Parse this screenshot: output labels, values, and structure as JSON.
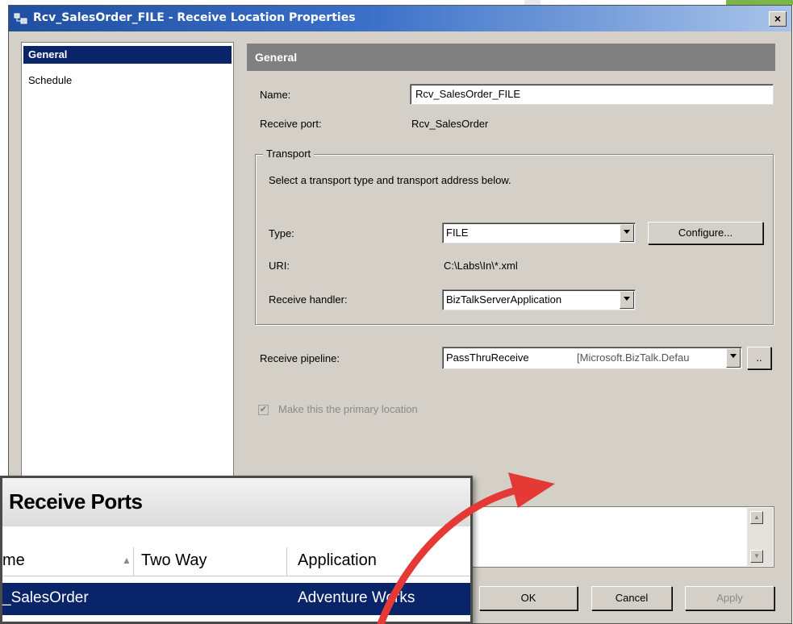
{
  "dialog": {
    "title": "Rcv_SalesOrder_FILE - Receive Location Properties",
    "close_glyph": "×"
  },
  "nav": {
    "items": [
      {
        "label": "General",
        "selected": true
      },
      {
        "label": "Schedule",
        "selected": false
      }
    ]
  },
  "general": {
    "header": "General",
    "name_label": "Name:",
    "name_value": "Rcv_SalesOrder_FILE",
    "receive_port_label": "Receive port:",
    "receive_port_value": "Rcv_SalesOrder",
    "transport": {
      "legend": "Transport",
      "instruction": "Select a transport type and transport address below.",
      "type_label": "Type:",
      "type_value": "FILE",
      "configure_label": "Configure...",
      "uri_label": "URI:",
      "uri_value": "C:\\Labs\\In\\*.xml",
      "handler_label": "Receive handler:",
      "handler_value": "BizTalkServerApplication"
    },
    "pipeline_label": "Receive pipeline:",
    "pipeline_name": "PassThruReceive",
    "pipeline_assembly": "[Microsoft.BizTalk.Defau",
    "pipeline_browse": "..",
    "primary_location_label": "Make this the primary location",
    "primary_location_checked": true
  },
  "buttons": {
    "ok": "OK",
    "cancel": "Cancel",
    "apply": "Apply"
  },
  "receive_ports": {
    "title": "Receive Ports",
    "columns": [
      "me",
      "Two Way",
      "Application"
    ],
    "sort_glyph": "▲",
    "row": {
      "name": "_SalesOrder",
      "application": "Adventure Works"
    }
  },
  "colors": {
    "selection": "#0a246a",
    "arrow": "#e53935",
    "dialog_face": "#d4d0c8"
  },
  "icons": [
    "application-icon",
    "dropdown-arrow-icon",
    "checkbox-icon",
    "scroll-up-icon",
    "scroll-down-icon",
    "curved-arrow-icon"
  ]
}
